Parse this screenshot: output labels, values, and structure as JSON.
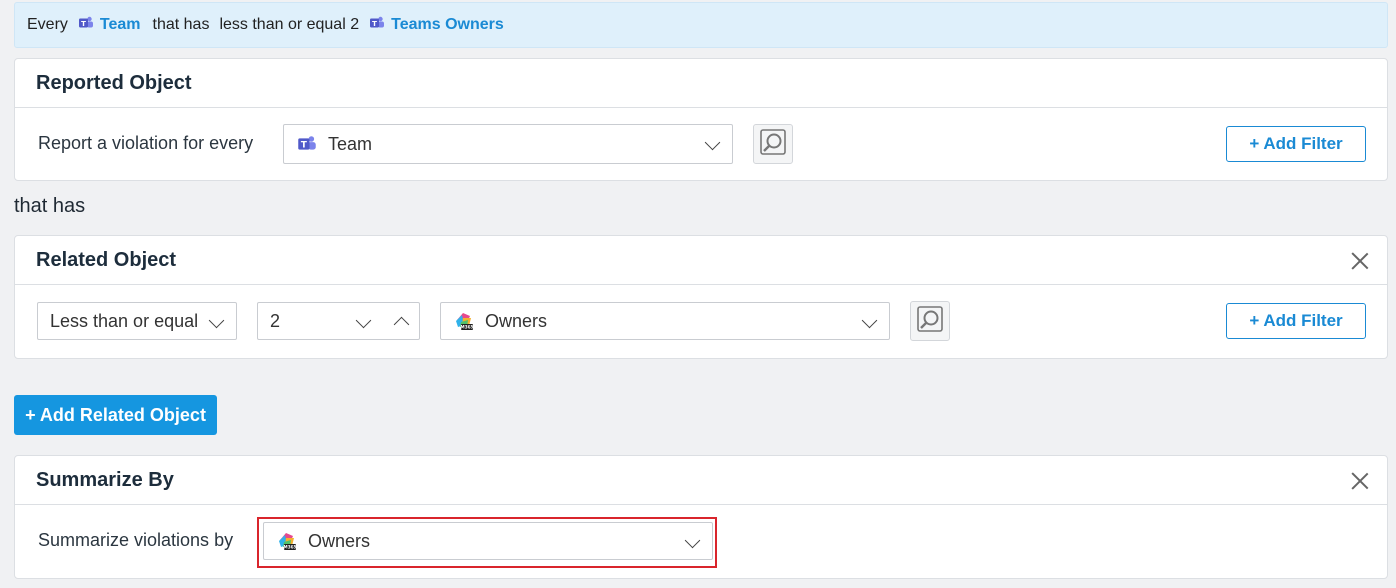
{
  "summary": {
    "every": "Every",
    "reported": "Team",
    "that_has": "that has",
    "condition": "less than or equal 2",
    "related": "Teams Owners"
  },
  "reported_object": {
    "title": "Reported Object",
    "label": "Report a violation for every",
    "selected": "Team",
    "add_filter": "+ Add Filter"
  },
  "connector": "that has",
  "related_object": {
    "title": "Related Object",
    "operator": "Less than or equal",
    "count": "2",
    "selected": "Owners",
    "add_filter": "+ Add Filter"
  },
  "add_related_label": "+ Add Related Object",
  "summarize": {
    "title": "Summarize By",
    "label": "Summarize violations by",
    "selected": "Owners"
  },
  "colors": {
    "accent": "#1a8ad4",
    "primary_button": "#1596e0",
    "highlight": "#d9252c",
    "teams": "#5059c9"
  },
  "icons": {
    "teams": "teams-icon",
    "m365": "m365-icon",
    "preview": "preview-search-icon",
    "close": "close-icon",
    "chevron": "chevron-down-icon"
  }
}
